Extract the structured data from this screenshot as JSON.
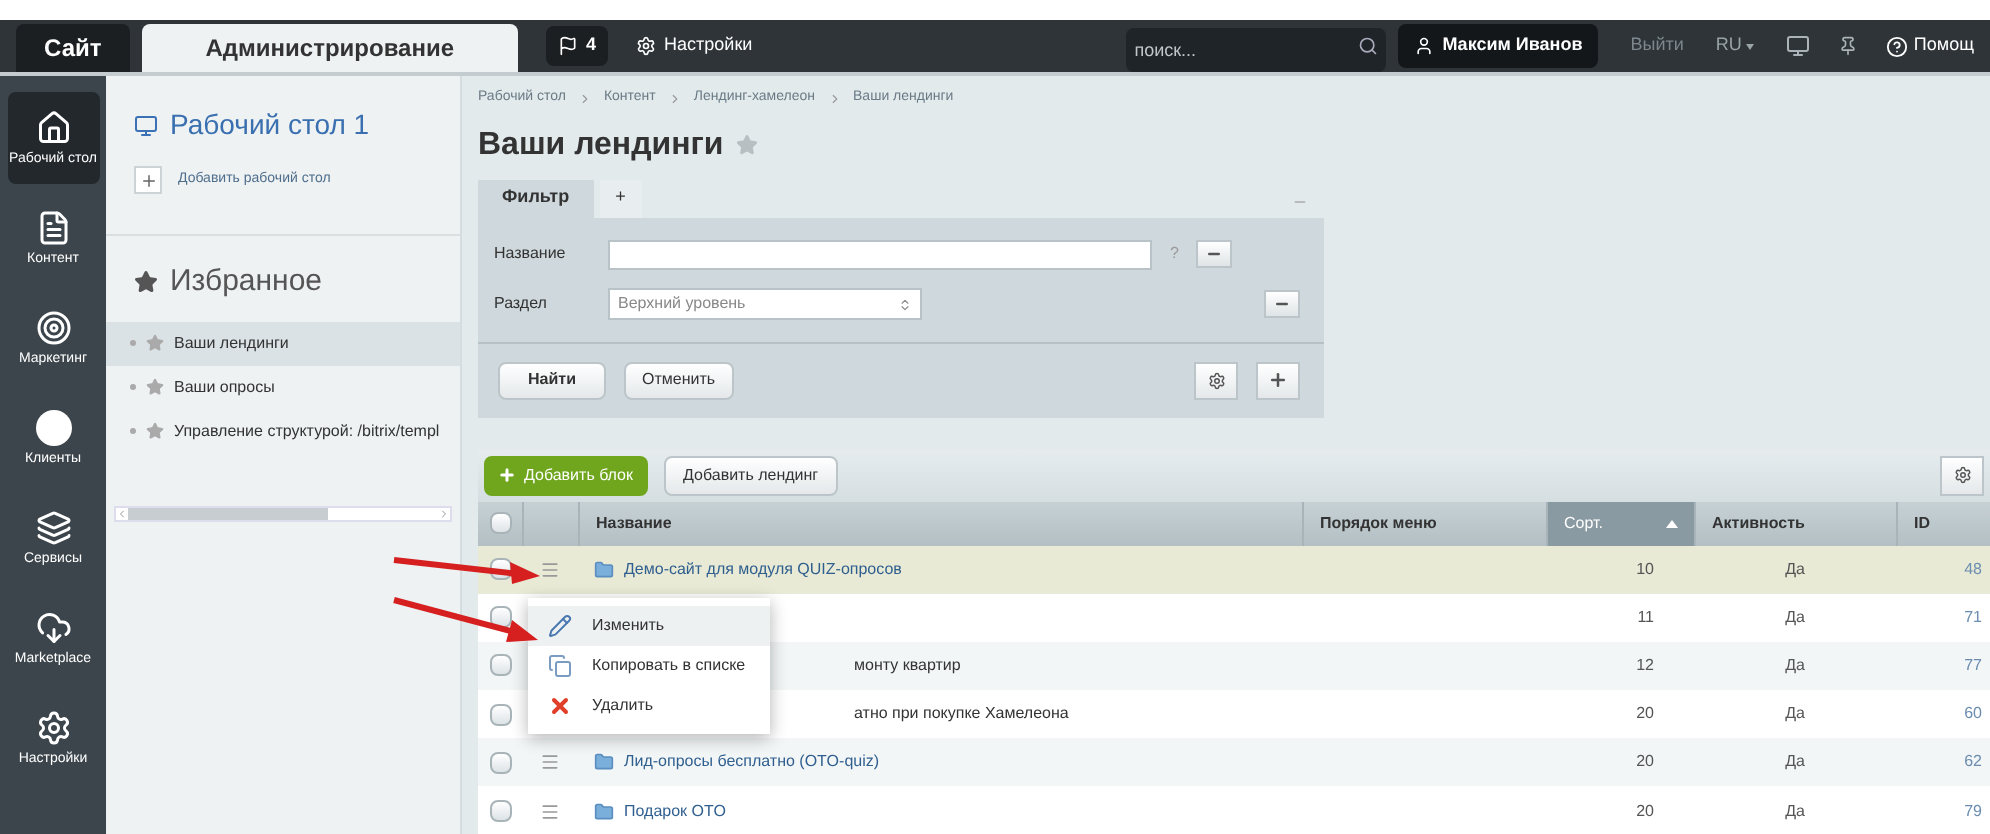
{
  "top_tabs": [
    {
      "label": "Сайт",
      "selected": false
    },
    {
      "label": "Администрирование",
      "selected": true
    }
  ],
  "notifications": {
    "count": "4"
  },
  "settings_link": "Настройки",
  "search": {
    "placeholder": "поиск..."
  },
  "user": "Максим Иванов",
  "logout": "Выйти",
  "language": {
    "label": "RU",
    "expanded": false
  },
  "help": "Помощ",
  "rail": [
    {
      "label": "Рабочий стол",
      "kind": "home",
      "selected": true
    },
    {
      "label": "Контент",
      "kind": "doc",
      "selected": false
    },
    {
      "label": "Маркетинг",
      "kind": "target",
      "selected": false
    },
    {
      "label": "Клиенты",
      "kind": "clients",
      "selected": false
    },
    {
      "label": "Сервисы",
      "kind": "layers",
      "selected": false
    },
    {
      "label": "Marketplace",
      "kind": "cloud",
      "selected": false
    },
    {
      "label": "Настройки",
      "kind": "gear",
      "selected": false
    }
  ],
  "sidebar": {
    "desktop": "Рабочий стол 1",
    "add_desktop": "Добавить рабочий стол",
    "favorites_title": "Избранное",
    "favorites": [
      {
        "label": "Ваши лендинги",
        "selected": true
      },
      {
        "label": "Ваши опросы",
        "selected": false
      },
      {
        "label": "Управление структурой: /bitrix/templ",
        "selected": false
      }
    ]
  },
  "breadcrumbs": [
    "Рабочий стол",
    "Контент",
    "Лендинг-хамелеон",
    "Ваши лендинги"
  ],
  "title": "Ваши лендинги",
  "filter": {
    "tabs": [
      {
        "label": "Фильтр",
        "selected": true
      },
      {
        "label": "+",
        "selected": false
      }
    ],
    "fields": [
      {
        "label": "Название",
        "kind": "text",
        "hint": "?"
      },
      {
        "label": "Раздел",
        "kind": "select",
        "value": "Верхний уровень"
      }
    ],
    "buttons": [
      "Найти",
      "Отменить"
    ]
  },
  "toolbar": {
    "add_block": "Добавить блок",
    "add_landing": "Добавить лендинг"
  },
  "table": {
    "select_all": {
      "checked": false
    },
    "columns": [
      {
        "label": "Название",
        "sorted": false
      },
      {
        "label": "Порядок меню",
        "sorted": false
      },
      {
        "label": "Сорт.",
        "sorted": true
      },
      {
        "label": "Активность",
        "sorted": false
      },
      {
        "label": "ID",
        "sorted": false
      }
    ],
    "rows": [
      {
        "name": "Демо-сайт для модуля QUIZ-опросов",
        "covered": false,
        "highlighted": true,
        "sort": "10",
        "active": "Да",
        "id": "48"
      },
      {
        "highlighted": false,
        "sort": "11",
        "active": "Да",
        "id": "71"
      },
      {
        "name": "монту квартир",
        "covered": true,
        "highlighted": false,
        "sort": "12",
        "active": "Да",
        "id": "77"
      },
      {
        "name": "атно при покупке Хамелеона",
        "covered": true,
        "highlighted": false,
        "sort": "20",
        "active": "Да",
        "id": "60"
      },
      {
        "name": "Лид-опросы бесплатно (OTO-quiz)",
        "covered": false,
        "highlighted": false,
        "sort": "20",
        "active": "Да",
        "id": "62"
      },
      {
        "name": "Подарок OTO",
        "covered": false,
        "highlighted": false,
        "sort": "20",
        "active": "Да",
        "id": "79"
      }
    ]
  },
  "context_menu": [
    {
      "label": "Изменить",
      "kind": "edit",
      "selected": true
    },
    {
      "label": "Копировать в списке",
      "kind": "copy",
      "selected": false
    },
    {
      "label": "Удалить",
      "kind": "delete",
      "selected": false
    }
  ]
}
